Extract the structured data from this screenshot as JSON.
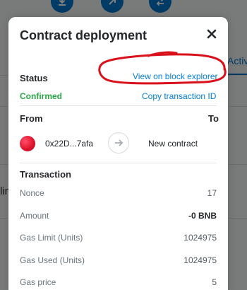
{
  "modal": {
    "title": "Contract deployment",
    "close_icon": "close-icon",
    "status_label": "Status",
    "explorer_link": "View on block explorer",
    "status_value": "Confirmed",
    "copy_link": "Copy transaction ID",
    "from_label": "From",
    "to_label": "To",
    "from_address": "0x22D...7afa",
    "arrow_icon": "arrow-right-icon",
    "to_value": "New contract",
    "transaction_heading": "Transaction",
    "rows": [
      {
        "label": "Nonce",
        "value": "17"
      },
      {
        "label": "Amount",
        "value": "-0 BNB"
      },
      {
        "label": "Gas Limit (Units)",
        "value": "1024975"
      },
      {
        "label": "Gas Used (Units)",
        "value": "1024975"
      },
      {
        "label": "Gas price",
        "value": "5"
      }
    ]
  },
  "background": {
    "tab_label": "Activi",
    "side_text": "lin"
  },
  "colors": {
    "accent": "#037dd6",
    "success": "#28a745",
    "annotation": "#d9111b"
  }
}
